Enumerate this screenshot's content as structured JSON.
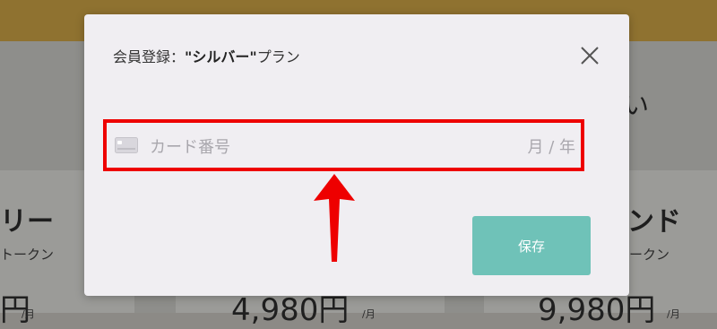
{
  "background": {
    "plans": [
      {
        "name": "リー",
        "token": "トークン",
        "price": "円",
        "unit": "/月"
      },
      {
        "name": "",
        "token": "",
        "price": "4,980円",
        "unit": "/月"
      },
      {
        "name": "ンド",
        "token": "ークン",
        "price": "9,980円",
        "unit": "/月"
      }
    ],
    "heading_fragment": "い"
  },
  "modal": {
    "title_prefix": "会員登録：",
    "plan_name": "\"シルバー\"",
    "title_suffix": "プラン",
    "close_label": "×",
    "card_field": {
      "placeholder": "カード番号",
      "expiry": "月 / 年",
      "icon": "credit-card-icon"
    },
    "save_label": "保存"
  },
  "annotation": {
    "highlight_color": "#ee0000",
    "arrow_color": "#ee0000"
  },
  "colors": {
    "save_button": "#6fc2b8",
    "modal_bg": "#f0eef2",
    "top_bar": "#8f7230"
  }
}
